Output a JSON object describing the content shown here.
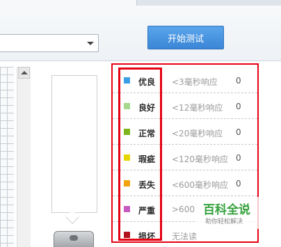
{
  "toolbar": {
    "start_button_label": "开始测试"
  },
  "legend": {
    "rows": [
      {
        "name": "优良",
        "threshold": "<3毫秒响应",
        "count": "0",
        "color": "#3aa0e3"
      },
      {
        "name": "良好",
        "threshold": "<12毫秒响应",
        "count": "0",
        "color": "#a8d88c"
      },
      {
        "name": "正常",
        "threshold": "<20毫秒响应",
        "count": "0",
        "color": "#7cb51e"
      },
      {
        "name": "瑕疵",
        "threshold": "<120毫秒响应",
        "count": "0",
        "color": "#e6d600"
      },
      {
        "name": "丢失",
        "threshold": "<600毫秒响应",
        "count": "0",
        "color": "#f2a20d"
      },
      {
        "name": "严重",
        "threshold": ">600",
        "count": "",
        "color": "#c65bbf"
      },
      {
        "name": "损坏",
        "threshold": "无法读",
        "count": "",
        "color": "#b3121c"
      }
    ]
  },
  "watermark": {
    "title": "百科全说",
    "subtitle": "助你轻松解决"
  },
  "colors": {
    "highlight": "#e60012",
    "button": "#4a97e2"
  }
}
